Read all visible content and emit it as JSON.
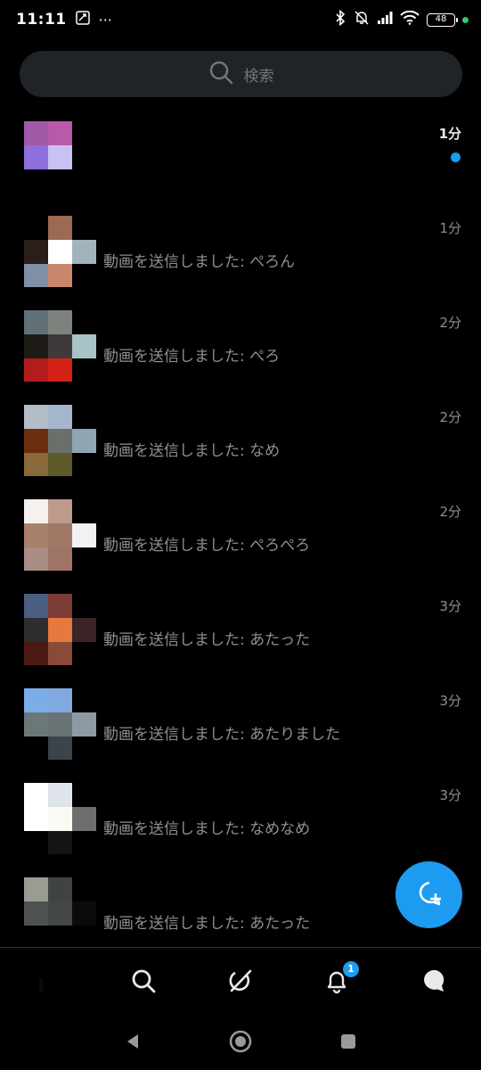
{
  "status_bar": {
    "time": "11:11",
    "dots": "···",
    "battery": "48",
    "colors": {
      "charge_dot": "#2ecc71"
    }
  },
  "search": {
    "placeholder": "検索",
    "icon": "search-icon"
  },
  "conversations": [
    {
      "time": "1分",
      "preview": "",
      "unread": true,
      "avatar": [
        "#a05aa8",
        "#b85aa8",
        "#8d6fdc",
        "#c9c0f4",
        "#000000",
        "#000000"
      ],
      "side": "#000000"
    },
    {
      "time": "1分",
      "preview": "動画を送信しました: ぺろん",
      "unread": false,
      "avatar": [
        "#000000",
        "#9a6a52",
        "#2b1d18",
        "#ffffff",
        "#7f8fa6",
        "#c8876a"
      ],
      "side": "#a2b3be"
    },
    {
      "time": "2分",
      "preview": "動画を送信しました: ぺろ",
      "unread": false,
      "avatar": [
        "#5f7177",
        "#7e827c",
        "#1f1b17",
        "#3e3a3b",
        "#b31c1c",
        "#d62116"
      ],
      "side": "#a8c3c8"
    },
    {
      "time": "2分",
      "preview": "動画を送信しました: なめ",
      "unread": false,
      "avatar": [
        "#b3bdc8",
        "#a5b6cc",
        "#6c2d10",
        "#6a6f6c",
        "#8a6a3a",
        "#5f5a2b"
      ],
      "side": "#8ea5b2"
    },
    {
      "time": "2分",
      "preview": "動画を送信しました: ぺろぺろ",
      "unread": false,
      "avatar": [
        "#f7f1ee",
        "#bd9a8c",
        "#a8806b",
        "#a07967",
        "#a98c84",
        "#9f7466"
      ],
      "side": "#f2f2f2"
    },
    {
      "time": "3分",
      "preview": "動画を送信しました: あたった",
      "unread": false,
      "avatar": [
        "#4a5f82",
        "#7d3b36",
        "#2e2e30",
        "#e8793c",
        "#4b1a12",
        "#8a4a3a"
      ],
      "side": "#3a2426"
    },
    {
      "time": "3分",
      "preview": "動画を送信しました: あたりました",
      "unread": false,
      "avatar": [
        "#7aaee8",
        "#7faae0",
        "#6c7878",
        "#6a7375",
        "#000000",
        "#3b434b"
      ],
      "side": "#8d9aa3"
    },
    {
      "time": "3分",
      "preview": "動画を送信しました: なめなめ",
      "unread": false,
      "avatar": [
        "#ffffff",
        "#dfe3ea",
        "#ffffff",
        "#fafaf4",
        "#000000",
        "#141414"
      ],
      "side": "#6e6e6e"
    },
    {
      "time": "",
      "preview": "動画を送信しました: あたった",
      "unread": false,
      "avatar": [
        "#9a9c94",
        "#3f4342",
        "#4f5350",
        "#434745",
        "#000000",
        "#000000"
      ],
      "side": "#0b0b0b"
    }
  ],
  "fab": {
    "icon": "new-message-icon"
  },
  "bottom_nav": {
    "items": [
      "home-icon",
      "search-icon",
      "grok-icon",
      "notifications-icon",
      "messages-icon"
    ],
    "notification_badge": "1"
  },
  "system_nav": {
    "items": [
      "back-icon",
      "home-circle-icon",
      "recents-icon"
    ]
  },
  "colors": {
    "background": "#000000",
    "accent": "#1d9bf0",
    "search_bg": "#202327",
    "muted_text": "#8b9096"
  }
}
